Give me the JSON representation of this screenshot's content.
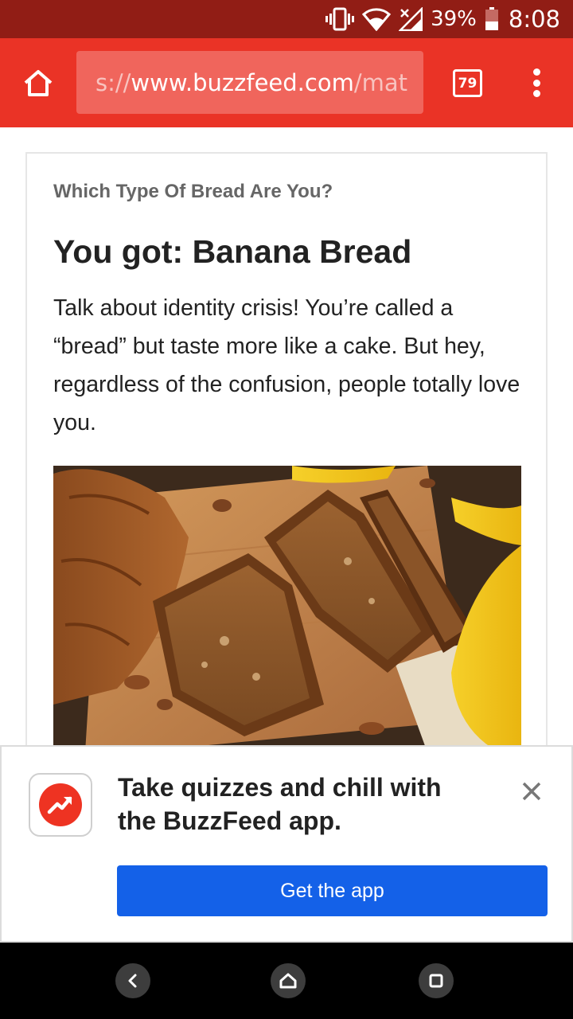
{
  "status_bar": {
    "battery_percent": "39%",
    "time": "8:08",
    "icons": [
      "vibrate-icon",
      "wifi-icon",
      "signal-icon",
      "battery-icon"
    ]
  },
  "toolbar": {
    "url_prefix": "s://",
    "url_host": "www.buzzfeed.com",
    "url_path": "/mat",
    "tab_count": "79",
    "icons": [
      "home-icon",
      "more-vert-icon"
    ]
  },
  "article": {
    "quiz_title": "Which Type Of Bread Are You?",
    "result_heading": "You got: Banana Bread",
    "result_description": "Talk about identity crisis! You’re called a “bread” but taste more like a cake. But hey, regardless of the confusion, people totally love you."
  },
  "app_banner": {
    "message": "Take quizzes and chill with the BuzzFeed app.",
    "cta_label": "Get the app",
    "icons": [
      "buzzfeed-trending-icon",
      "close-icon"
    ]
  },
  "nav_bar": {
    "icons": [
      "back-icon",
      "home-nav-icon",
      "recents-icon"
    ]
  },
  "colors": {
    "status_bar": "#911d15",
    "toolbar": "#ea3326",
    "cta_button": "#1461e8",
    "brand_red": "#ee3322"
  }
}
